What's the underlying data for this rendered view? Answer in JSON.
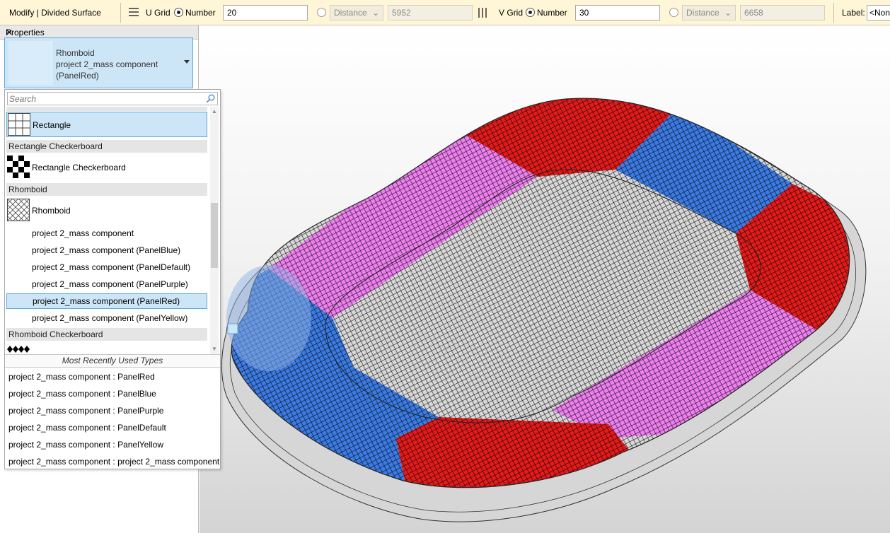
{
  "toolbar": {
    "context_title": "Modify | Divided Surface",
    "u_grid": {
      "label": "U Grid",
      "number_label": "Number",
      "number_value": "20",
      "distance_label": "Distance",
      "distance_value": "5952"
    },
    "v_grid": {
      "label": "V Grid",
      "number_label": "Number",
      "number_value": "30",
      "distance_label": "Distance",
      "distance_value": "6658"
    },
    "label_caption": "Label:",
    "label_value": "<Non"
  },
  "properties": {
    "title": "Properties",
    "type_selector": {
      "line1": "Rhomboid",
      "line2": "project 2_mass component",
      "line3": "(PanelRed)"
    },
    "dropdown": {
      "search_placeholder": "Search",
      "items": [
        {
          "kind": "item",
          "label": "Rectangle",
          "thumb": "rectangle-grid",
          "selected": true
        },
        {
          "kind": "group",
          "label": "Rectangle Checkerboard"
        },
        {
          "kind": "item",
          "label": "Rectangle Checkerboard",
          "thumb": "checkerboard"
        },
        {
          "kind": "group",
          "label": "Rhomboid"
        },
        {
          "kind": "item",
          "label": "Rhomboid",
          "thumb": "rhomboid"
        },
        {
          "kind": "sub",
          "label": "project 2_mass component"
        },
        {
          "kind": "sub",
          "label": "project 2_mass component (PanelBlue)"
        },
        {
          "kind": "sub",
          "label": "project 2_mass component (PanelDefault)"
        },
        {
          "kind": "sub",
          "label": "project 2_mass component (PanelPurple)"
        },
        {
          "kind": "sub",
          "label": "project 2_mass component (PanelRed)",
          "selected": true
        },
        {
          "kind": "sub",
          "label": "project 2_mass component (PanelYellow)"
        },
        {
          "kind": "group",
          "label": "Rhomboid Checkerboard"
        }
      ],
      "mru_title": "Most Recently Used Types",
      "mru": [
        "project 2_mass component : PanelRed",
        "project 2_mass component : PanelBlue",
        "project 2_mass component : PanelPurple",
        "project 2_mass component : PanelDefault",
        "project 2_mass component : PanelYellow",
        "project 2_mass component : project 2_mass component"
      ]
    }
  },
  "colors": {
    "accent": "#5aa8dd",
    "selection_bg": "#cde6f7",
    "options_bar": "#fff6d8",
    "panel_red": "#e41b1b",
    "panel_blue": "#3c7be3",
    "panel_purple": "#ee7fef"
  }
}
